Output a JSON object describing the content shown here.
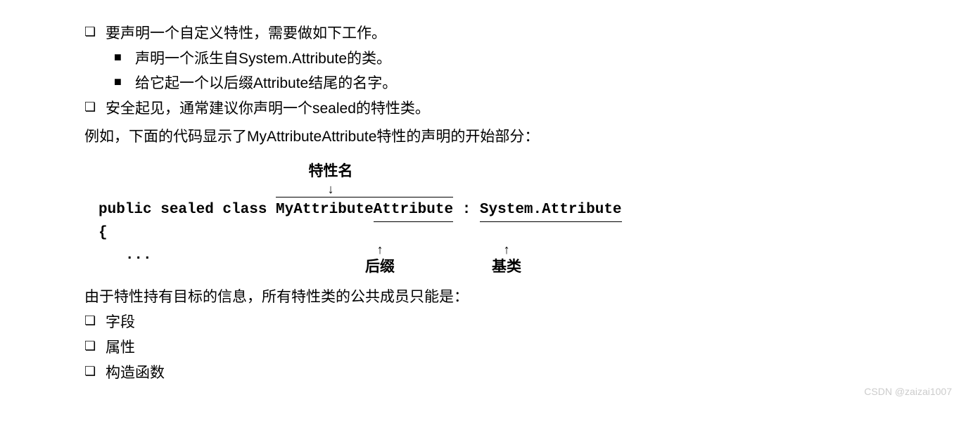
{
  "bullets": {
    "b1": "要声明一个自定义特性，需要做如下工作。",
    "b1a": "声明一个派生自System.Attribute的类。",
    "b1b": "给它起一个以后缀Attribute结尾的名字。",
    "b2": "安全起见，通常建议你声明一个sealed的特性类。"
  },
  "p1": "例如，下面的代码显示了MyAttributeAttribute特性的声明的开始部分：",
  "anno": {
    "top": "特性名",
    "suffix": "后缀",
    "base": "基类"
  },
  "code": {
    "prefix": "public sealed class ",
    "name1": "MyAttribute",
    "name2": "Attribute",
    "sep": " : ",
    "base": "System.Attribute",
    "brace": "{",
    "dots": "..."
  },
  "p2": "由于特性持有目标的信息，所有特性类的公共成员只能是：",
  "bullets2": {
    "c1": "字段",
    "c2": "属性",
    "c3": "构造函数"
  },
  "markers": {
    "hollow": "❏",
    "solid": "■"
  },
  "watermark": "CSDN @zaizai1007"
}
